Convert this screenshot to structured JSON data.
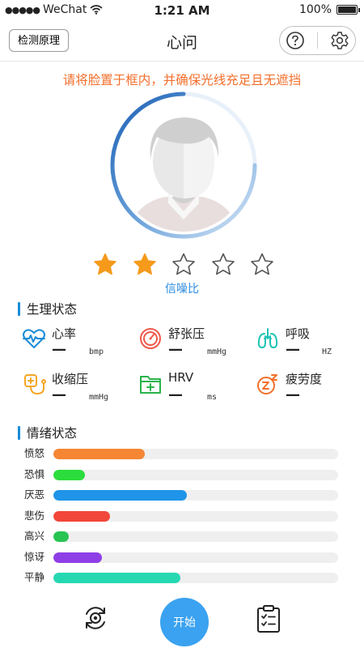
{
  "status_bar": {
    "carrier": "WeChat",
    "time": "1:21 AM",
    "battery": "100%"
  },
  "nav": {
    "left_button": "检测原理",
    "title": "心问"
  },
  "hint": "请将脸置于框内，并确保光线充足且无遮挡",
  "snr": {
    "label": "信噪比",
    "rating": 2,
    "max": 5
  },
  "physio": {
    "title": "生理状态",
    "metrics": [
      {
        "label": "心率",
        "value": "—",
        "unit": "bmp",
        "icon": "heart-pulse-icon",
        "color": "#1a8cd8"
      },
      {
        "label": "舒张压",
        "value": "—",
        "unit": "mmHg",
        "icon": "gauge-icon",
        "color": "#f0594c"
      },
      {
        "label": "呼吸",
        "value": "—",
        "unit": "HZ",
        "icon": "lungs-icon",
        "color": "#1cc3b5"
      },
      {
        "label": "收缩压",
        "value": "—",
        "unit": "mmHg",
        "icon": "blood-pressure-cuff-icon",
        "color": "#f5a623"
      },
      {
        "label": "HRV",
        "value": "—",
        "unit": "ms",
        "icon": "folder-plus-icon",
        "color": "#27b34a"
      },
      {
        "label": "疲劳度",
        "value": "—",
        "unit": "",
        "icon": "sleep-zz-icon",
        "color": "#f36f2b"
      }
    ]
  },
  "emotion": {
    "title": "情绪状态",
    "items": [
      {
        "label": "愤怒",
        "level": 0.32,
        "color": "#f58634"
      },
      {
        "label": "恐惧",
        "level": 0.11,
        "color": "#2bdc3c"
      },
      {
        "label": "厌恶",
        "level": 0.47,
        "color": "#1f94e8"
      },
      {
        "label": "悲伤",
        "level": 0.2,
        "color": "#f2463a"
      },
      {
        "label": "高兴",
        "level": 0.055,
        "color": "#27c452"
      },
      {
        "label": "惊讶",
        "level": 0.17,
        "color": "#8e3fe6"
      },
      {
        "label": "平静",
        "level": 0.445,
        "color": "#26d8b2"
      }
    ]
  },
  "bottom": {
    "start_label": "开始",
    "left_icon": "camera-switch-icon",
    "right_icon": "report-clipboard-icon"
  },
  "colors": {
    "accent": "#3aa2f0",
    "hint": "#f36f2b",
    "star_on": "#f59a1b",
    "star_off": "#555555",
    "section_bar": "#1a8cd8"
  }
}
